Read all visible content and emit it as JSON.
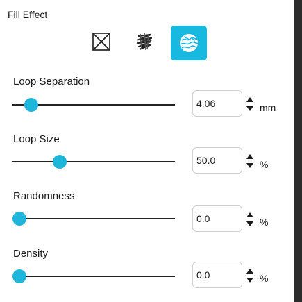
{
  "section": {
    "title": "Fill Effect"
  },
  "fill_effects": [
    {
      "icon": "none-fill-icon",
      "selected": false
    },
    {
      "icon": "scribble-fill-icon",
      "selected": false
    },
    {
      "icon": "loop-fill-icon",
      "selected": true
    }
  ],
  "colors": {
    "accent": "#18b9e0",
    "slider_thumb": "#1fb6dc",
    "track": "#222222"
  },
  "params": {
    "loop_separation": {
      "label": "Loop Separation",
      "value": "4.06",
      "unit": "mm",
      "slider_fraction": 0.08
    },
    "loop_size": {
      "label": "Loop Size",
      "value": "50.0",
      "unit": "%",
      "slider_fraction": 0.27
    },
    "randomness": {
      "label": "Randomness",
      "value": "0.0",
      "unit": "%",
      "slider_fraction": 0.0
    },
    "density": {
      "label": "Density",
      "value": "0.0",
      "unit": "%",
      "slider_fraction": 0.0
    }
  }
}
